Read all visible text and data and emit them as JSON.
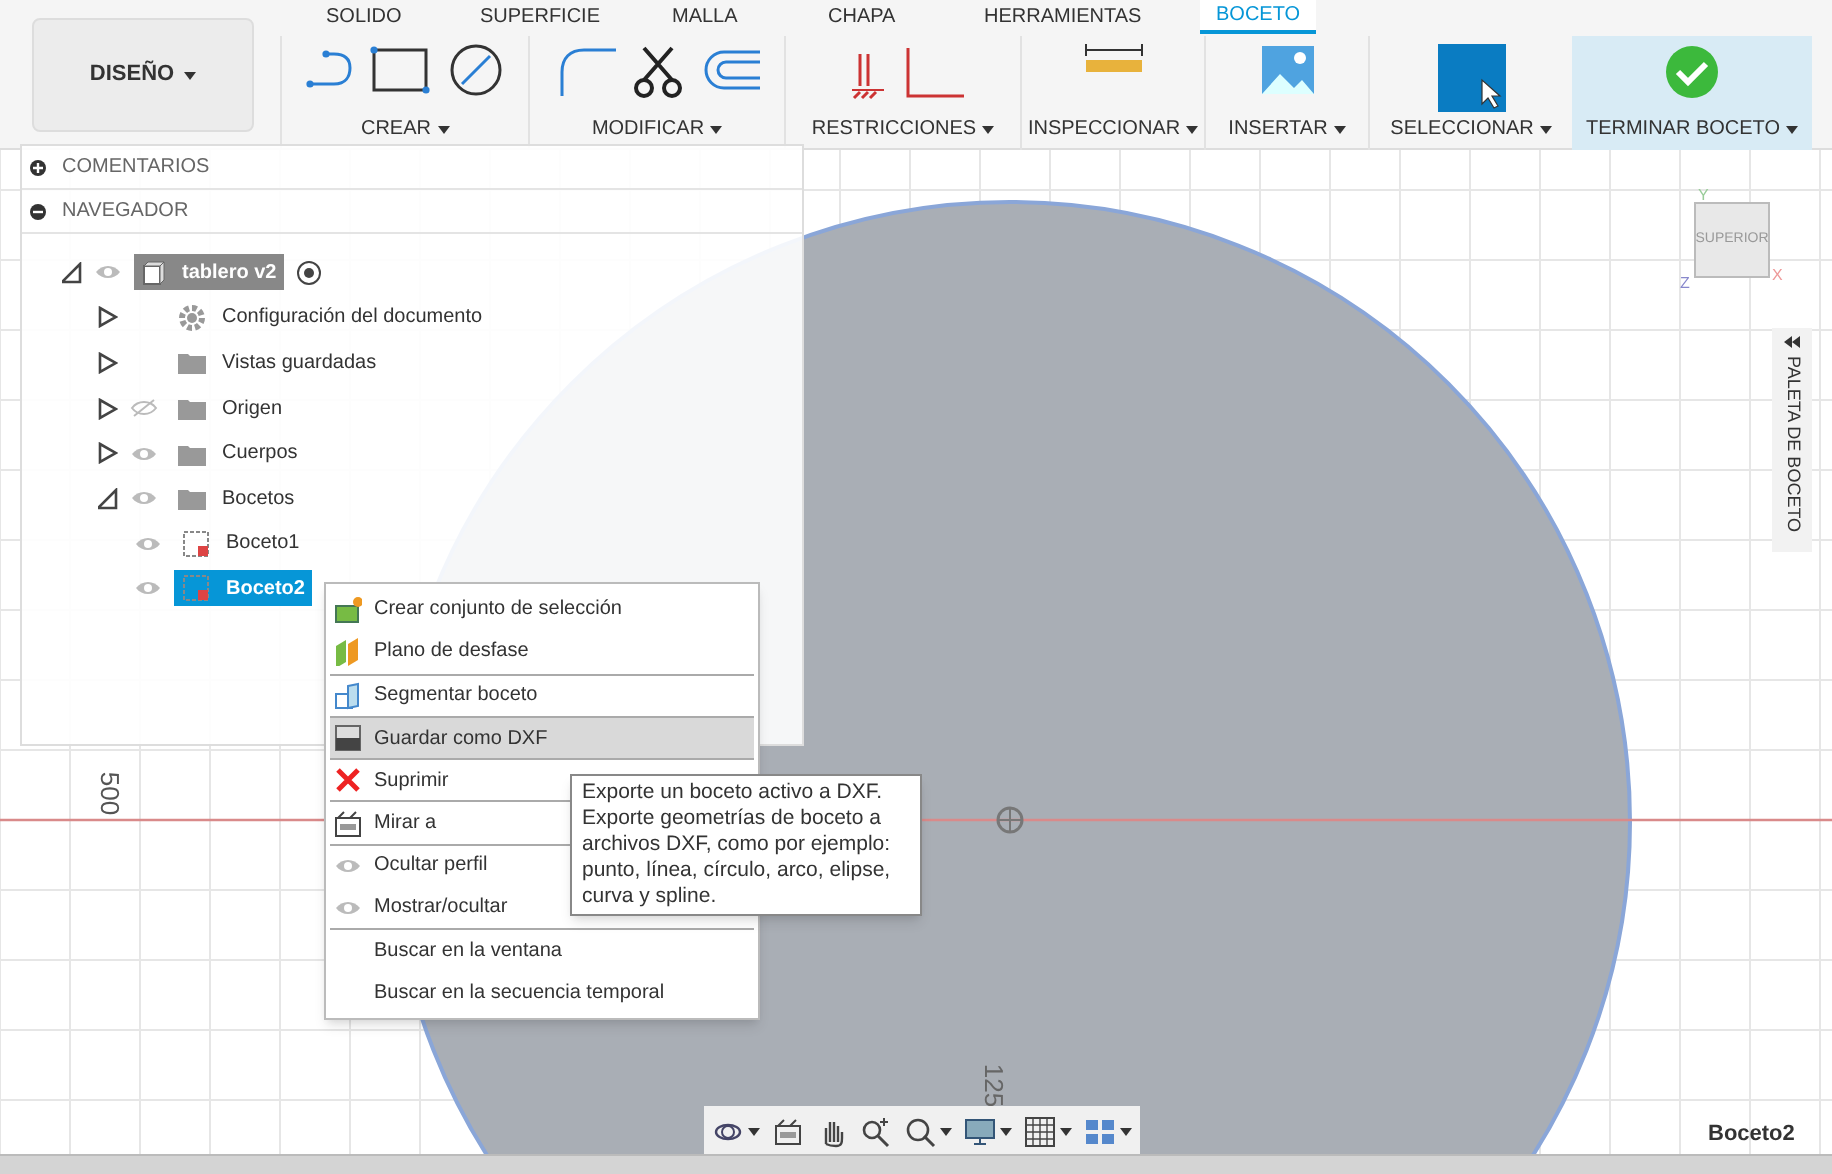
{
  "ribbon_tabs": [
    {
      "label": "SOLIDO",
      "selected": false
    },
    {
      "label": "SUPERFICIE",
      "selected": false
    },
    {
      "label": "MALLA",
      "selected": false
    },
    {
      "label": "CHAPA",
      "selected": false
    },
    {
      "label": "HERRAMIENTAS",
      "selected": false
    },
    {
      "label": "BOCETO",
      "selected": true
    }
  ],
  "workspace_button": {
    "label": "DISEÑO"
  },
  "tool_groups": [
    {
      "label": "CREAR",
      "kind": "create",
      "highlighted": false
    },
    {
      "label": "MODIFICAR",
      "kind": "modify",
      "highlighted": false
    },
    {
      "label": "RESTRICCIONES",
      "kind": "constraints",
      "highlighted": false
    },
    {
      "label": "INSPECCIONAR",
      "kind": "inspect",
      "highlighted": false
    },
    {
      "label": "INSERTAR",
      "kind": "insert",
      "highlighted": false
    },
    {
      "label": "SELECCIONAR",
      "kind": "select",
      "highlighted": false
    },
    {
      "label": "TERMINAR BOCETO",
      "kind": "finish",
      "highlighted": true
    }
  ],
  "panels": [
    {
      "label": "COMENTARIOS",
      "expanded": false
    },
    {
      "label": "NAVEGADOR",
      "expanded": true
    }
  ],
  "tree": {
    "label": "tablero v2",
    "kind": "component",
    "expanded": true,
    "visible": true,
    "selected": false,
    "children": [
      {
        "label": "Configuración del documento",
        "kind": "settings",
        "expanded": false,
        "selected": false
      },
      {
        "label": "Vistas guardadas",
        "kind": "folder",
        "expanded": false,
        "selected": false
      },
      {
        "label": "Origen",
        "kind": "folder",
        "expanded": false,
        "visible": false,
        "selected": false
      },
      {
        "label": "Cuerpos",
        "kind": "folder",
        "expanded": false,
        "visible": true,
        "selected": false
      },
      {
        "label": "Bocetos",
        "kind": "folder",
        "expanded": true,
        "visible": true,
        "selected": false,
        "children": [
          {
            "label": "Boceto1",
            "kind": "sketch",
            "visible": true,
            "selected": false
          },
          {
            "label": "Boceto2",
            "kind": "sketch",
            "visible": true,
            "selected": true
          }
        ]
      }
    ]
  },
  "context_menu": [
    {
      "label": "Crear conjunto de selección",
      "kind": "selection-set",
      "separator_before": false,
      "selected": false
    },
    {
      "label": "Plano de desfase",
      "kind": "offset-plane",
      "separator_before": false,
      "selected": false
    },
    {
      "label": "Segmentar boceto",
      "kind": "slice",
      "separator_before": true,
      "selected": false
    },
    {
      "label": "Guardar como DXF",
      "kind": "dxf",
      "separator_before": true,
      "selected": true
    },
    {
      "label": "Suprimir",
      "kind": "delete",
      "separator_before": true,
      "selected": false
    },
    {
      "label": "Mirar a",
      "kind": "look-at",
      "separator_before": true,
      "selected": false
    },
    {
      "label": "Ocultar perfil",
      "kind": "eye",
      "separator_before": true,
      "selected": false
    },
    {
      "label": "Mostrar/ocultar",
      "kind": "eye",
      "separator_before": false,
      "selected": false
    },
    {
      "label": "Buscar en la ventana",
      "kind": "none",
      "separator_before": true,
      "selected": false
    },
    {
      "label": "Buscar en la secuencia temporal",
      "kind": "none",
      "separator_before": false,
      "selected": false
    }
  ],
  "tooltip": {
    "lines": [
      "Exporte un boceto activo a DXF.",
      "Exporte geometrías de boceto a",
      "archivos DXF, como por ejemplo:",
      "punto, línea, círculo, arco, elipse,",
      "curva y spline."
    ]
  },
  "viewcube": {
    "face": "SUPERIOR",
    "axis_y": "Y",
    "axis_x": "X",
    "axis_z": "Z"
  },
  "palette_tab": {
    "label": "PALETA DE BOCETO"
  },
  "ruler_labels": [
    "500",
    "125"
  ],
  "sketch_name": "Boceto2"
}
